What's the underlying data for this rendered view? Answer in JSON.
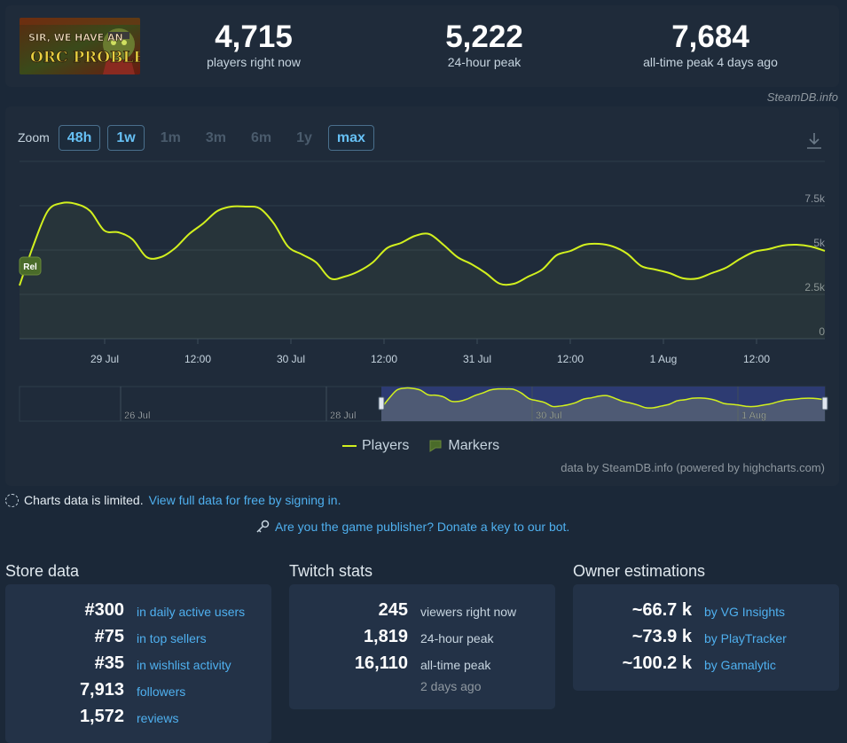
{
  "header": {
    "thumb_alt_text": "SIR, WE HAVE AN ORC PROBLEM",
    "stats": [
      {
        "value": "4,715",
        "label": "players right now"
      },
      {
        "value": "5,222",
        "label": "24-hour peak"
      },
      {
        "value": "7,684",
        "label": "all-time peak 4 days ago"
      }
    ],
    "credit": "SteamDB.info"
  },
  "chart": {
    "zoom_label": "Zoom",
    "zoom_options": [
      {
        "label": "48h",
        "active": true
      },
      {
        "label": "1w",
        "active": true
      },
      {
        "label": "1m",
        "active": false
      },
      {
        "label": "3m",
        "active": false
      },
      {
        "label": "6m",
        "active": false
      },
      {
        "label": "1y",
        "active": false
      },
      {
        "label": "max",
        "active": true
      }
    ],
    "legend": {
      "players": "Players",
      "markers": "Markers"
    },
    "credit": "data by SteamDB.info (powered by highcharts.com)",
    "marker_label": "Rel",
    "navigator_labels": [
      "26 Jul",
      "28 Jul",
      "30 Jul",
      "1 Aug"
    ]
  },
  "chart_data": {
    "type": "line",
    "title": "",
    "xlabel": "",
    "ylabel": "",
    "x_ticks": [
      "29 Jul",
      "12:00",
      "30 Jul",
      "12:00",
      "31 Jul",
      "12:00",
      "1 Aug",
      "12:00"
    ],
    "y_ticks": [
      "0",
      "2.5k",
      "5k",
      "7.5k"
    ],
    "ylim": [
      0,
      10000
    ],
    "grid": true,
    "series": [
      {
        "name": "Players",
        "color": "#d2f01e",
        "x": [
          "28 Jul 03:00",
          "28 Jul 05:00",
          "28 Jul 07:00",
          "28 Jul 09:00",
          "28 Jul 11:00",
          "28 Jul 13:00",
          "28 Jul 15:00",
          "28 Jul 17:00",
          "28 Jul 19:00",
          "28 Jul 21:00",
          "28 Jul 23:00",
          "29 Jul 01:00",
          "29 Jul 03:00",
          "29 Jul 05:00",
          "29 Jul 07:00",
          "29 Jul 09:00",
          "29 Jul 11:00",
          "29 Jul 13:00",
          "29 Jul 15:00",
          "29 Jul 17:00",
          "29 Jul 19:00",
          "29 Jul 21:00",
          "29 Jul 23:00",
          "30 Jul 01:00",
          "30 Jul 03:00",
          "30 Jul 05:00",
          "30 Jul 07:00",
          "30 Jul 09:00",
          "30 Jul 11:00",
          "30 Jul 13:00",
          "30 Jul 15:00",
          "30 Jul 17:00",
          "30 Jul 19:00",
          "30 Jul 21:00",
          "30 Jul 23:00",
          "31 Jul 01:00",
          "31 Jul 03:00",
          "31 Jul 05:00",
          "31 Jul 07:00",
          "31 Jul 09:00",
          "31 Jul 11:00",
          "31 Jul 13:00",
          "31 Jul 15:00",
          "31 Jul 17:00",
          "31 Jul 19:00",
          "31 Jul 21:00",
          "31 Jul 23:00",
          "1 Aug 01:00",
          "1 Aug 03:00",
          "1 Aug 05:00",
          "1 Aug 07:00",
          "1 Aug 09:00",
          "1 Aug 11:00",
          "1 Aug 13:00",
          "1 Aug 15:00",
          "1 Aug 17:00",
          "1 Aug 19:00",
          "1 Aug 21:00"
        ],
        "y": [
          3000,
          5300,
          7200,
          7650,
          7600,
          7200,
          6100,
          6000,
          5600,
          4600,
          4600,
          5100,
          5900,
          6500,
          7200,
          7450,
          7450,
          7350,
          6500,
          5200,
          4750,
          4300,
          3400,
          3500,
          3800,
          4300,
          5100,
          5400,
          5800,
          5900,
          5300,
          4600,
          4200,
          3700,
          3100,
          3100,
          3500,
          3900,
          4700,
          4950,
          5300,
          5350,
          5200,
          4800,
          4100,
          3900,
          3700,
          3400,
          3400,
          3700,
          4000,
          4500,
          4900,
          5050,
          5250,
          5300,
          5200,
          4950
        ]
      }
    ],
    "markers": [
      {
        "label": "Rel",
        "x": "28 Jul 03:00"
      }
    ]
  },
  "notices": {
    "limit_text": "Charts data is limited.",
    "limit_link": "View full data for free by signing in.",
    "publisher_link": "Are you the game publisher? Donate a key to our bot."
  },
  "store": {
    "title": "Store data",
    "rows": [
      {
        "value": "#300",
        "label": "in daily active users"
      },
      {
        "value": "#75",
        "label": "in top sellers"
      },
      {
        "value": "#35",
        "label": "in wishlist activity"
      },
      {
        "value": "7,913",
        "label": "followers"
      },
      {
        "value": "1,572",
        "label": "reviews"
      }
    ]
  },
  "twitch": {
    "title": "Twitch stats",
    "rows": [
      {
        "value": "245",
        "label": "viewers right now"
      },
      {
        "value": "1,819",
        "label": "24-hour peak"
      },
      {
        "value": "16,110",
        "label": "all-time peak"
      }
    ],
    "extra": "2 days ago"
  },
  "owners": {
    "title": "Owner estimations",
    "rows": [
      {
        "value": "~66.7 k",
        "label": "by VG Insights"
      },
      {
        "value": "~73.9 k",
        "label": "by PlayTracker"
      },
      {
        "value": "~100.2 k",
        "label": "by Gamalytic"
      }
    ]
  },
  "colors": {
    "accent": "#66c0f4",
    "link": "#4fb0ef",
    "line": "#d2f01e",
    "marker": "#4a6b2a"
  }
}
